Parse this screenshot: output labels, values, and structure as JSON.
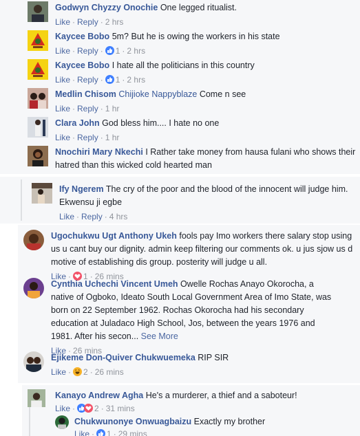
{
  "actions": {
    "like": "Like",
    "reply": "Reply",
    "sep": "·",
    "see_more": "See More"
  },
  "comments": [
    {
      "name": "Godwyn Chyzzy Onochie",
      "text": "One legged ritualist.",
      "time": "2 hrs"
    },
    {
      "name": "Kaycee Bobo",
      "text": "5m? But he is owing the workers in his state",
      "reactions": "1",
      "time": "2 hrs"
    },
    {
      "name": "Kaycee Bobo",
      "text": "I hate all the politicians in this country",
      "reactions": "1",
      "time": "2 hrs"
    },
    {
      "name": "Medlin Chisom",
      "tag": "Chijioke Nappyblaze",
      "text": "Come n see",
      "time": "1 hr"
    },
    {
      "name": "Clara John",
      "text": "God bless him.... I hate no one",
      "time": "1 hr"
    },
    {
      "name": "Nnochiri Mary Nkechi",
      "text": "I Rather take money from hausa fulani who shows their hatred than this wicked cold hearted man"
    },
    {
      "name": "Ify Ngerem",
      "text": "The cry of the poor and the blood of the innocent will judge him. Ekwensu ji egbe",
      "time": "4 hrs"
    },
    {
      "name": "Ugochukwu Ugt Anthony Ukeh",
      "text": "fools pay Imo workers there salary stop using us u cant buy our dignity. admin keep filtering our comments ok. u jus sjow us d motive of establishing dis group. posterity will judge u all.",
      "reactions": "1",
      "time": "26 mins"
    },
    {
      "name": "Cynthia Uchechi Vincent Umeh",
      "text": "Owelle Rochas Anayo Okorocha, a native of Ogboko, Ideato South Local Government Area of Imo State, was born on 22 September 1962. Rochas Okorocha had his secondary education at Juladaco High School, Jos, between the years 1976 and 1981. After his secon...",
      "time": "26 mins"
    },
    {
      "name": "Ejikeme Don-Quiver Chukwuemeka",
      "text": "RIP SIR",
      "reactions": "2",
      "time": "26 mins"
    },
    {
      "name": "Kanayo Andrew Agha",
      "text": "He's a murderer, a thief and a saboteur!",
      "reactions": "2",
      "time": "31 mins"
    },
    {
      "name": "Chukwunonye Onwuagbaizu",
      "text": "Exactly my brother",
      "reactions": "1",
      "time": "29 mins"
    }
  ],
  "colors": {
    "name": "#385898",
    "link": "#4b67a1",
    "meta": "#90949c",
    "bg": "#f6f7f9"
  }
}
